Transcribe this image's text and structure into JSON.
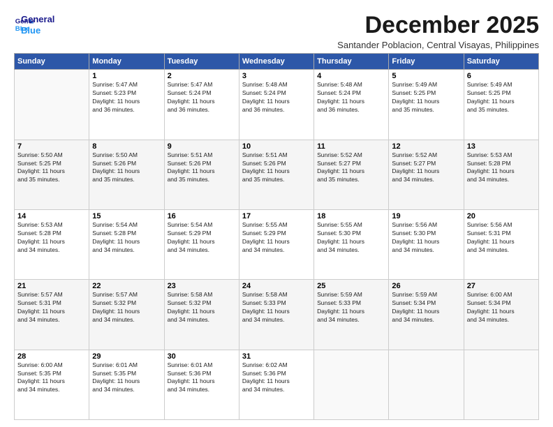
{
  "logo": {
    "line1": "General",
    "line2": "Blue"
  },
  "title": "December 2025",
  "subtitle": "Santander Poblacion, Central Visayas, Philippines",
  "days_of_week": [
    "Sunday",
    "Monday",
    "Tuesday",
    "Wednesday",
    "Thursday",
    "Friday",
    "Saturday"
  ],
  "weeks": [
    [
      {
        "day": "",
        "info": ""
      },
      {
        "day": "1",
        "info": "Sunrise: 5:47 AM\nSunset: 5:23 PM\nDaylight: 11 hours\nand 36 minutes."
      },
      {
        "day": "2",
        "info": "Sunrise: 5:47 AM\nSunset: 5:24 PM\nDaylight: 11 hours\nand 36 minutes."
      },
      {
        "day": "3",
        "info": "Sunrise: 5:48 AM\nSunset: 5:24 PM\nDaylight: 11 hours\nand 36 minutes."
      },
      {
        "day": "4",
        "info": "Sunrise: 5:48 AM\nSunset: 5:24 PM\nDaylight: 11 hours\nand 36 minutes."
      },
      {
        "day": "5",
        "info": "Sunrise: 5:49 AM\nSunset: 5:25 PM\nDaylight: 11 hours\nand 35 minutes."
      },
      {
        "day": "6",
        "info": "Sunrise: 5:49 AM\nSunset: 5:25 PM\nDaylight: 11 hours\nand 35 minutes."
      }
    ],
    [
      {
        "day": "7",
        "info": "Sunrise: 5:50 AM\nSunset: 5:25 PM\nDaylight: 11 hours\nand 35 minutes."
      },
      {
        "day": "8",
        "info": "Sunrise: 5:50 AM\nSunset: 5:26 PM\nDaylight: 11 hours\nand 35 minutes."
      },
      {
        "day": "9",
        "info": "Sunrise: 5:51 AM\nSunset: 5:26 PM\nDaylight: 11 hours\nand 35 minutes."
      },
      {
        "day": "10",
        "info": "Sunrise: 5:51 AM\nSunset: 5:26 PM\nDaylight: 11 hours\nand 35 minutes."
      },
      {
        "day": "11",
        "info": "Sunrise: 5:52 AM\nSunset: 5:27 PM\nDaylight: 11 hours\nand 35 minutes."
      },
      {
        "day": "12",
        "info": "Sunrise: 5:52 AM\nSunset: 5:27 PM\nDaylight: 11 hours\nand 34 minutes."
      },
      {
        "day": "13",
        "info": "Sunrise: 5:53 AM\nSunset: 5:28 PM\nDaylight: 11 hours\nand 34 minutes."
      }
    ],
    [
      {
        "day": "14",
        "info": "Sunrise: 5:53 AM\nSunset: 5:28 PM\nDaylight: 11 hours\nand 34 minutes."
      },
      {
        "day": "15",
        "info": "Sunrise: 5:54 AM\nSunset: 5:28 PM\nDaylight: 11 hours\nand 34 minutes."
      },
      {
        "day": "16",
        "info": "Sunrise: 5:54 AM\nSunset: 5:29 PM\nDaylight: 11 hours\nand 34 minutes."
      },
      {
        "day": "17",
        "info": "Sunrise: 5:55 AM\nSunset: 5:29 PM\nDaylight: 11 hours\nand 34 minutes."
      },
      {
        "day": "18",
        "info": "Sunrise: 5:55 AM\nSunset: 5:30 PM\nDaylight: 11 hours\nand 34 minutes."
      },
      {
        "day": "19",
        "info": "Sunrise: 5:56 AM\nSunset: 5:30 PM\nDaylight: 11 hours\nand 34 minutes."
      },
      {
        "day": "20",
        "info": "Sunrise: 5:56 AM\nSunset: 5:31 PM\nDaylight: 11 hours\nand 34 minutes."
      }
    ],
    [
      {
        "day": "21",
        "info": "Sunrise: 5:57 AM\nSunset: 5:31 PM\nDaylight: 11 hours\nand 34 minutes."
      },
      {
        "day": "22",
        "info": "Sunrise: 5:57 AM\nSunset: 5:32 PM\nDaylight: 11 hours\nand 34 minutes."
      },
      {
        "day": "23",
        "info": "Sunrise: 5:58 AM\nSunset: 5:32 PM\nDaylight: 11 hours\nand 34 minutes."
      },
      {
        "day": "24",
        "info": "Sunrise: 5:58 AM\nSunset: 5:33 PM\nDaylight: 11 hours\nand 34 minutes."
      },
      {
        "day": "25",
        "info": "Sunrise: 5:59 AM\nSunset: 5:33 PM\nDaylight: 11 hours\nand 34 minutes."
      },
      {
        "day": "26",
        "info": "Sunrise: 5:59 AM\nSunset: 5:34 PM\nDaylight: 11 hours\nand 34 minutes."
      },
      {
        "day": "27",
        "info": "Sunrise: 6:00 AM\nSunset: 5:34 PM\nDaylight: 11 hours\nand 34 minutes."
      }
    ],
    [
      {
        "day": "28",
        "info": "Sunrise: 6:00 AM\nSunset: 5:35 PM\nDaylight: 11 hours\nand 34 minutes."
      },
      {
        "day": "29",
        "info": "Sunrise: 6:01 AM\nSunset: 5:35 PM\nDaylight: 11 hours\nand 34 minutes."
      },
      {
        "day": "30",
        "info": "Sunrise: 6:01 AM\nSunset: 5:36 PM\nDaylight: 11 hours\nand 34 minutes."
      },
      {
        "day": "31",
        "info": "Sunrise: 6:02 AM\nSunset: 5:36 PM\nDaylight: 11 hours\nand 34 minutes."
      },
      {
        "day": "",
        "info": ""
      },
      {
        "day": "",
        "info": ""
      },
      {
        "day": "",
        "info": ""
      }
    ]
  ]
}
